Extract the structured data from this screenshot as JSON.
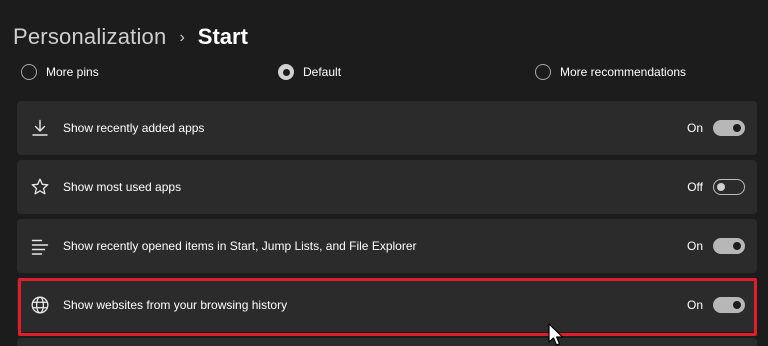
{
  "breadcrumb": {
    "parent": "Personalization",
    "separator": "›",
    "current": "Start"
  },
  "layout_options": [
    {
      "label": "More pins",
      "selected": false
    },
    {
      "label": "Default",
      "selected": true
    },
    {
      "label": "More recommendations",
      "selected": false
    }
  ],
  "settings": [
    {
      "icon": "download-icon",
      "label": "Show recently added apps",
      "state": "On",
      "on": true
    },
    {
      "icon": "star-icon",
      "label": "Show most used apps",
      "state": "Off",
      "on": false
    },
    {
      "icon": "list-icon",
      "label": "Show recently opened items in Start, Jump Lists, and File Explorer",
      "state": "On",
      "on": true
    },
    {
      "icon": "globe-icon",
      "label": "Show websites from your browsing history",
      "state": "On",
      "on": true
    }
  ],
  "colors": {
    "background": "#1c1c1c",
    "card": "#2b2b2b",
    "highlight": "#e01e2b"
  }
}
